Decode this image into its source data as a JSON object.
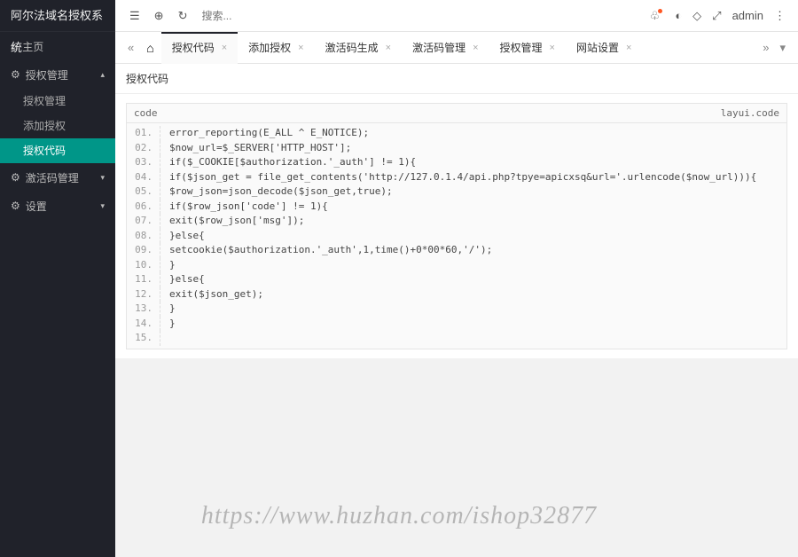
{
  "logo": "阿尔法域名授权系统",
  "sidebar": {
    "home": "主页",
    "auth_mgmt": "授权管理",
    "auth_mgmt_items": [
      "授权管理",
      "添加授权",
      "授权代码"
    ],
    "activate_mgmt": "激活码管理",
    "settings": "设置"
  },
  "header": {
    "search_placeholder": "搜索...",
    "admin": "admin"
  },
  "tabs": {
    "items": [
      {
        "label": "授权代码",
        "active": true,
        "closable": true
      },
      {
        "label": "添加授权",
        "active": false,
        "closable": true
      },
      {
        "label": "激活码生成",
        "active": false,
        "closable": true
      },
      {
        "label": "激活码管理",
        "active": false,
        "closable": true
      },
      {
        "label": "授权管理",
        "active": false,
        "closable": true
      },
      {
        "label": "网站设置",
        "active": false,
        "closable": true
      }
    ]
  },
  "card": {
    "title": "授权代码"
  },
  "code": {
    "title_left": "code",
    "title_right": "layui.code",
    "lines": [
      "error_reporting(E_ALL ^ E_NOTICE);",
      "$now_url=$_SERVER['HTTP_HOST'];",
      "if($_COOKIE[$authorization.'_auth'] != 1){",
      "if($json_get = file_get_contents('http://127.0.1.4/api.php?tpye=apicxsq&url='.urlencode($now_url))){",
      "$row_json=json_decode($json_get,true);",
      "if($row_json['code'] != 1){",
      "exit($row_json['msg']);",
      "}else{",
      "setcookie($authorization.'_auth',1,time()+0*00*60,'/');",
      "}",
      "}else{",
      "exit($json_get);",
      "}",
      "}",
      ""
    ]
  },
  "watermark": "https://www.huzhan.com/ishop32877"
}
